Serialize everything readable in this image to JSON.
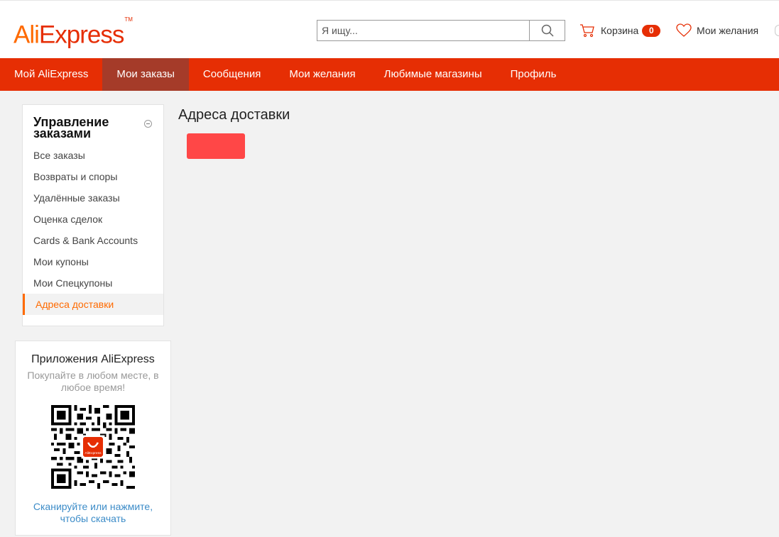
{
  "brand": {
    "logo_part1": "Ali",
    "logo_part2": "Express",
    "trademark": "TM",
    "accent_color": "#e62e04",
    "logo_orange": "#ff6a00"
  },
  "search": {
    "placeholder": "Я ищу...",
    "value": "",
    "icon": "search-icon"
  },
  "header": {
    "cart_label": "Корзина",
    "cart_count": "0",
    "cart_icon": "cart-icon",
    "wishlist_label": "Мои желания",
    "wishlist_icon": "heart-icon"
  },
  "nav": {
    "items": [
      {
        "label": "Мой AliExpress",
        "active": false
      },
      {
        "label": "Мои заказы",
        "active": true
      },
      {
        "label": "Сообщения",
        "active": false
      },
      {
        "label": "Мои желания",
        "active": false
      },
      {
        "label": "Любимые магазины",
        "active": false
      },
      {
        "label": "Профиль",
        "active": false
      }
    ],
    "bg_color": "#e62e04",
    "active_color": "#a53b29"
  },
  "sidebar": {
    "title": "Управление заказами",
    "items": [
      {
        "label": "Все заказы"
      },
      {
        "label": "Возвраты и споры"
      },
      {
        "label": "Удалённые заказы"
      },
      {
        "label": "Оценка сделок"
      },
      {
        "label": "Cards & Bank Accounts"
      },
      {
        "label": "Мои купоны"
      },
      {
        "label": "Мои Спецкупоны"
      },
      {
        "label": "Адреса доставки",
        "active": true
      }
    ]
  },
  "app_promo": {
    "title": "Приложения AliExpress",
    "subtitle": "Покупайте в любом месте, в любое время!",
    "qr_icon": "qr-code-icon",
    "app_logo_text": "AliExpress",
    "link": "Сканируйте или нажмите, чтобы скачать"
  },
  "main": {
    "title": "Адреса доставки",
    "button_color": "#ff4747"
  }
}
